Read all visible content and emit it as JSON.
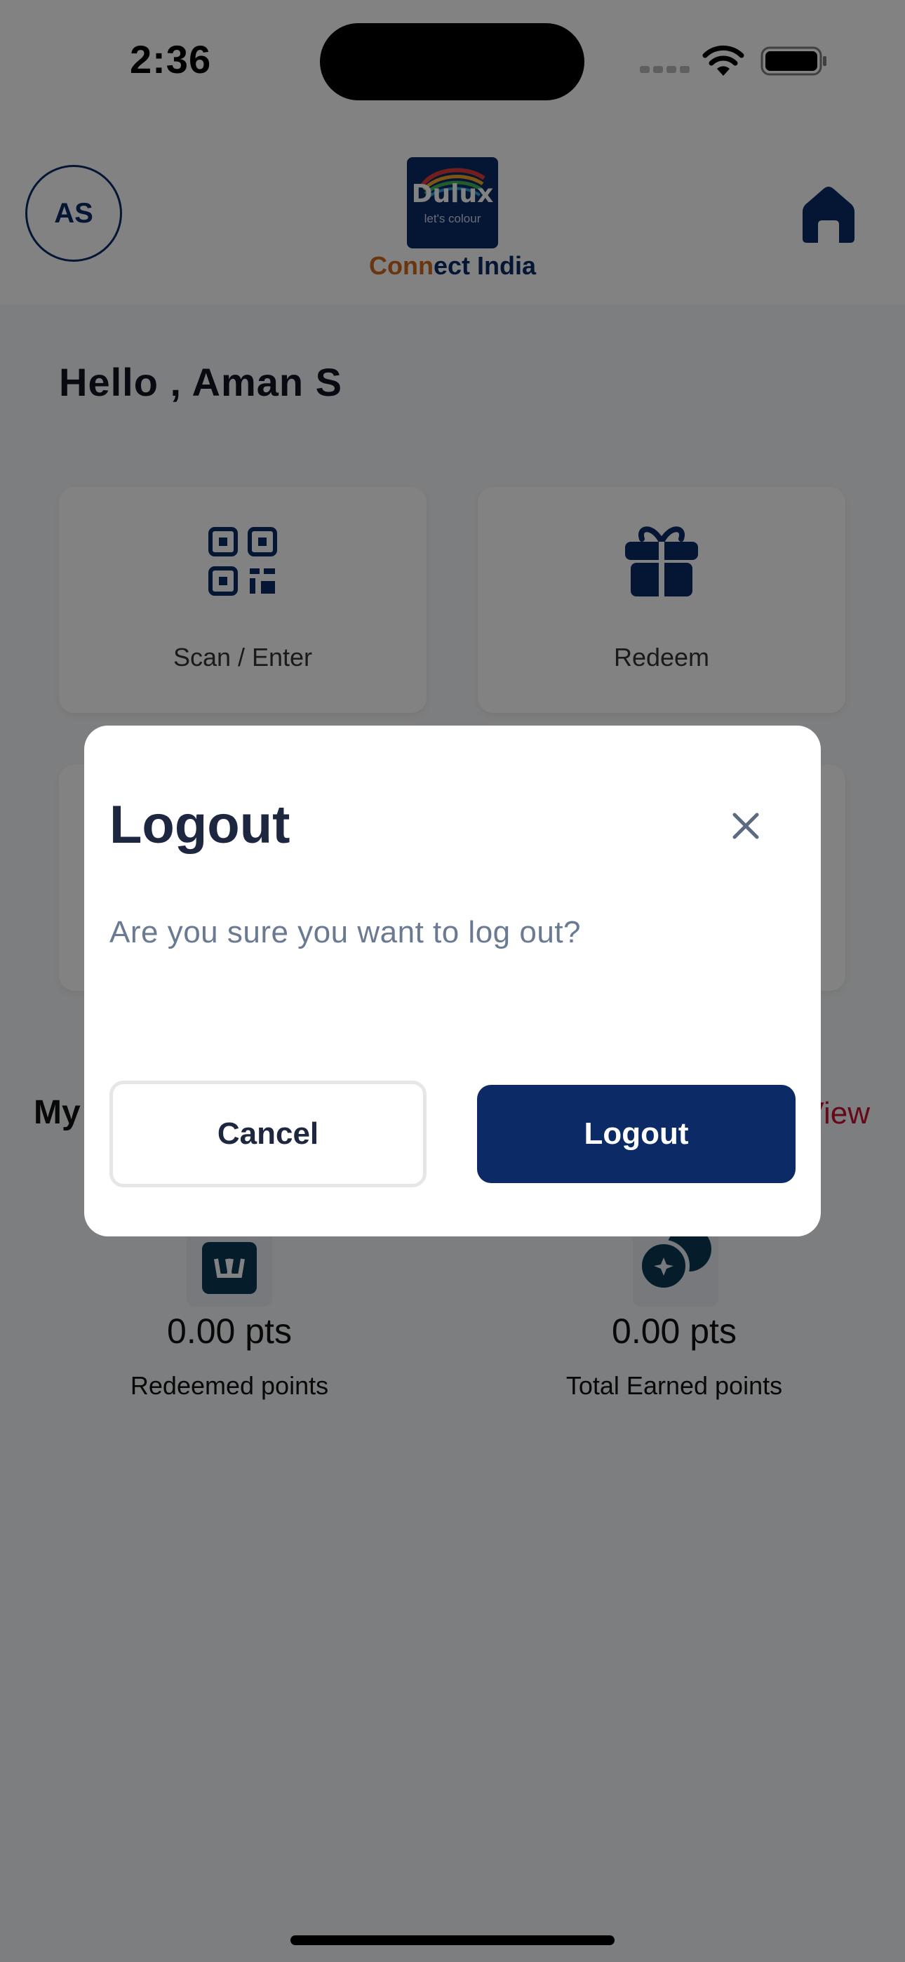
{
  "status_bar": {
    "time": "2:36"
  },
  "header": {
    "avatar_initials": "AS",
    "logo": {
      "brand": "Dulux",
      "tagline": "let's colour",
      "connect_part1": "Conn",
      "connect_part2": "ect India"
    },
    "home_icon": "home-icon"
  },
  "main": {
    "greeting": "Hello , Aman S",
    "tiles": [
      {
        "label": "Scan / Enter",
        "icon": "qr-code-icon"
      },
      {
        "label": "Redeem",
        "icon": "gift-icon"
      }
    ],
    "section_title": "My",
    "section_link": "View",
    "stats": [
      {
        "value": "0.00 pts",
        "label": "Redeemed points",
        "icon": "shop-icon"
      },
      {
        "value": "0.00 pts",
        "label": "Total Earned points",
        "icon": "coins-icon"
      }
    ]
  },
  "modal": {
    "title": "Logout",
    "message": "Are you sure you want to log out?",
    "cancel_label": "Cancel",
    "confirm_label": "Logout",
    "close_icon": "close-icon"
  },
  "colors": {
    "primary": "#0b2a66",
    "accent": "#c8102e",
    "orange": "#d2691e"
  }
}
